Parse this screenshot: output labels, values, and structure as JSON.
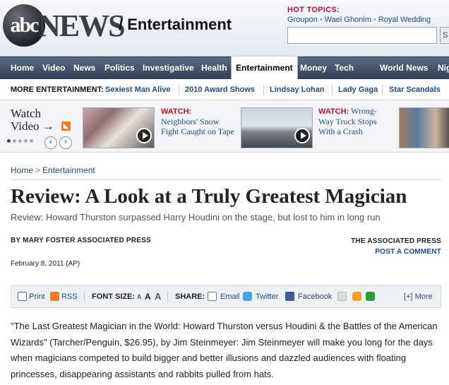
{
  "header": {
    "logo_abc": "abc",
    "logo_news": "NEWS",
    "section": "/ Entertainment",
    "hot_topics_label": "HOT TOPICS:",
    "hot_topics": [
      "Groupon",
      "Wael Ghonim",
      "Royal Wedding"
    ],
    "search_placeholder": "",
    "search_button": "S"
  },
  "nav": {
    "items": [
      "Home",
      "Video",
      "News",
      "Politics",
      "Investigative",
      "Health",
      "Entertainment",
      "Money",
      "Tech",
      "World News",
      "Nig"
    ],
    "active": "Entertainment"
  },
  "more_entertainment": {
    "label": "MORE ENTERTAINMENT:",
    "links": [
      "Sexiest Man Alive",
      "2010 Award Shows",
      "Lindsay Lohan",
      "Lady Gaga",
      "Star Scandals"
    ]
  },
  "video_strip": {
    "title_line1": "Watch",
    "title_line2": "Video →",
    "rss": "◣",
    "prev": "‹",
    "next": "›",
    "items": [
      {
        "watch": "WATCH:",
        "caption": "Neighbors' Snow Fight Caught on Tape"
      },
      {
        "watch": "WATCH:",
        "caption": "Wrong-Way Truck Stops With a Crash"
      }
    ]
  },
  "article": {
    "breadcrumb": [
      "Home",
      "Entertainment"
    ],
    "breadcrumb_sep": ">",
    "headline": "Review: A Look at a Truly Greatest Magician",
    "subhead": "Review: Howard Thurston surpassed Harry Houdini on the stage, but lost to him in long run",
    "byline": "BY MARY FOSTER ASSOCIATED PRESS",
    "source": "THE ASSOCIATED PRESS",
    "post_comment": "POST A COMMENT",
    "date": "February 8, 2011 (AP)",
    "body": "\"The Last Greatest Magician in the World: Howard Thurston versus Houdini & the Battles of the American Wizards\" (Tarcher/Penguin, $26.95), by Jim Steinmeyer: Jim Steinmeyer will make you long for the days when magicians competed to build bigger and better illusions and dazzled audiences with floating princesses, disappearing assistants and rabbits pulled from hats."
  },
  "toolbar": {
    "print": "Print",
    "rss": "RSS",
    "font_size_label": "FONT SIZE:",
    "font_small": "A",
    "font_medium": "A",
    "font_large": "A",
    "share_label": "SHARE:",
    "email": "Email",
    "twitter": "Twitter",
    "facebook": "Facebook",
    "more": "[+] More"
  }
}
